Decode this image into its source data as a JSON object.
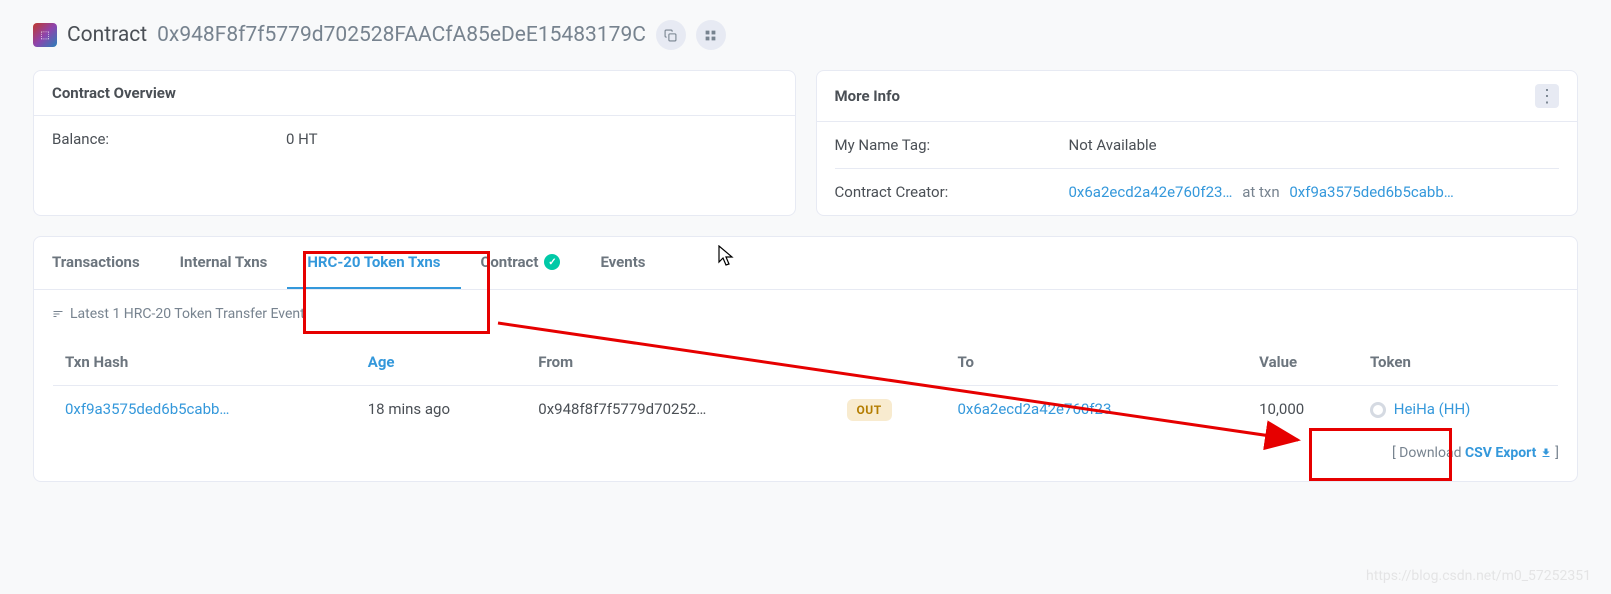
{
  "header": {
    "title": "Contract",
    "address": "0x948F8f7f5779d702528FAACfA85eDeE15483179C"
  },
  "overview": {
    "title": "Contract Overview",
    "balance_label": "Balance:",
    "balance_value": "0 HT"
  },
  "moreinfo": {
    "title": "More Info",
    "nametag_label": "My Name Tag:",
    "nametag_value": "Not Available",
    "creator_label": "Contract Creator:",
    "creator_address": "0x6a2ecd2a42e760f23…",
    "at_txn_label": "at txn",
    "creator_txn": "0xf9a3575ded6b5cabb…"
  },
  "tabs": {
    "items": [
      {
        "label": "Transactions",
        "active": false
      },
      {
        "label": "Internal Txns",
        "active": false
      },
      {
        "label": "HRC-20 Token Txns",
        "active": true
      },
      {
        "label": "Contract",
        "active": false,
        "verified": true
      },
      {
        "label": "Events",
        "active": false
      }
    ]
  },
  "summary": "Latest 1 HRC-20 Token Transfer Event",
  "table": {
    "headers": {
      "txn_hash": "Txn Hash",
      "age": "Age",
      "from": "From",
      "direction": "",
      "to": "To",
      "value": "Value",
      "token": "Token"
    },
    "rows": [
      {
        "txn_hash": "0xf9a3575ded6b5cabb…",
        "age": "18 mins ago",
        "from": "0x948f8f7f5779d70252…",
        "direction": "OUT",
        "to": "0x6a2ecd2a42e760f23…",
        "value": "10,000",
        "token": "HeiHa (HH)"
      }
    ]
  },
  "download": {
    "prefix": "[ Download ",
    "csv": "CSV Export",
    "suffix": " ]"
  },
  "watermark": "https://blog.csdn.net/m0_57252351"
}
